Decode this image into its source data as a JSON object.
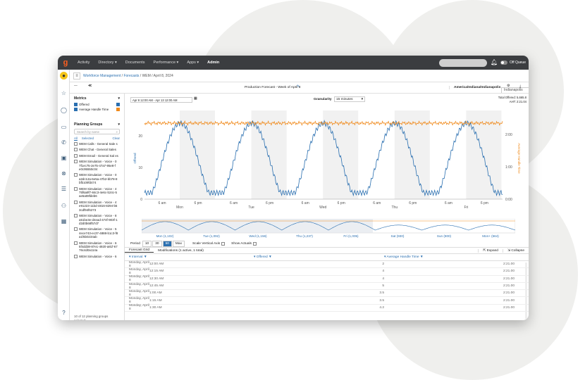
{
  "nav": {
    "items": [
      "Activity",
      "Directory ▾",
      "Documents",
      "Performance ▾",
      "Apps ▾",
      "Admin"
    ],
    "off_queue": "Off Queue"
  },
  "breadcrumb": {
    "items": [
      "Workforce Management",
      "Forecasts",
      "WEM / April 8, 2024"
    ],
    "timezone": "Indianapolis"
  },
  "toolbar": {
    "forecast_title": "Production Forecast - Week of April 8",
    "timezone": "America/Indiana/Indianapolis"
  },
  "range": {
    "date_range": "Apr 8 12:00 AM - Apr 13 12:00 AM",
    "granularity_label": "Granularity",
    "granularity_value": "15 minutes",
    "total_offered": "Total Offered: 5,665.8",
    "aht": "AHT: 2:21.04"
  },
  "sidebar": {
    "metrics_title": "Metrics",
    "metrics": [
      {
        "label": "Offered",
        "color": "#2a6fb0"
      },
      {
        "label": "Average Handle Time",
        "color": "#f08a1c"
      }
    ],
    "planning_title": "Planning Groups",
    "search_placeholder": "Search by name",
    "tabs": [
      "All",
      "Selected",
      "Clear"
    ],
    "groups": [
      "WEM Calls - General Sale s",
      "WEM Chat - General Sales",
      "WEM Email - General Sal es",
      "WEM Simulation - Voice - 0 7f1ec75-2e75-47a7-95e8-f e0c95550c04",
      "WEM Simulation - Voice - 0 a2dc12a-6e5a-47b2-bb78-8 bfb109fd474",
      "WEM Simulation - Voice - 4 75f6a9f7-84c3-4e6c-b24c-5 ae5a08fdeb6",
      "WEM Simulation - Voice - 4 e91223-11bd-4816-8294-b5 3cdf94f6273",
      "WEM Simulation - Voice - 8 a51be3e-d4ead-474f-903f-1 d2d0b68f57d7",
      "WEM Simulation - Voice - 5 4ece743-ec37-4888-b1c3-f8 a1f6b0234ab",
      "WEM Simulation - Voice - 6 5f4dd38-87e1-4920-a81f-67 76c4d0a114a",
      "WEM Simulation - Voice - 6"
    ],
    "footer": "10 of 12 planning groups selected"
  },
  "chart_data": {
    "type": "line",
    "title": "",
    "ylabel_left": "Offered",
    "ylabel_right": "Average Handle Time",
    "ylim_left": [
      0,
      28
    ],
    "yticks_left": [
      "0",
      "10",
      "20"
    ],
    "yticks_right": [
      "0:00",
      "1:00",
      "2:00"
    ],
    "xticks": [
      "6 am",
      "6 pm",
      "6 am",
      "6 pm",
      "6 am",
      "6 pm",
      "6 am",
      "6 pm",
      "6 am",
      "6 pm"
    ],
    "days": [
      "Mon",
      "Tue",
      "Wed",
      "Thu",
      "Fri"
    ],
    "series": [
      {
        "name": "Offered",
        "color": "#2a6fb0",
        "daily_shape": "rises from ~2 at midnight to peak ~24 around noon then falls to ~2"
      },
      {
        "name": "Average Handle Time",
        "color": "#f08a1c",
        "level": "2:21"
      }
    ]
  },
  "navigator": {
    "days": [
      "Mon (1,102)",
      "Tue (1,092)",
      "Wed (1,156)",
      "Thu (1,237)",
      "Fri (1,005)",
      "Sat (930)",
      "Sun (800)",
      "Mon+ (564)"
    ]
  },
  "period": {
    "label": "Period",
    "options": [
      "10",
      "30",
      "50",
      "Max"
    ],
    "active": "50",
    "scale_axis": "Scale Vertical Axis",
    "show_actuals": "Show Actuals"
  },
  "grid": {
    "tabs": [
      "Forecast Grid",
      "Modifications (1 active, 1 total)"
    ],
    "expand": "Expand",
    "collapse": "Collapse",
    "headers": [
      "Interval",
      "Offered",
      "Average Handle Time"
    ],
    "rows": [
      [
        "Monday, April 8",
        "12:00 AM",
        "2",
        "2:21.00"
      ],
      [
        "Monday, April 8",
        "12:15 AM",
        "4",
        "2:21.00"
      ],
      [
        "Monday, April 8",
        "12:30 AM",
        "4",
        "2:21.00"
      ],
      [
        "Monday, April 8",
        "12:45 AM",
        "5",
        "2:21.00"
      ],
      [
        "Monday, April 8",
        "1:00 AM",
        "3.5",
        "2:21.00"
      ],
      [
        "Monday, April 8",
        "1:15 AM",
        "3.5",
        "2:21.00"
      ],
      [
        "Monday, April 8",
        "1:30 AM",
        "4.2",
        "2:21.00"
      ]
    ]
  }
}
